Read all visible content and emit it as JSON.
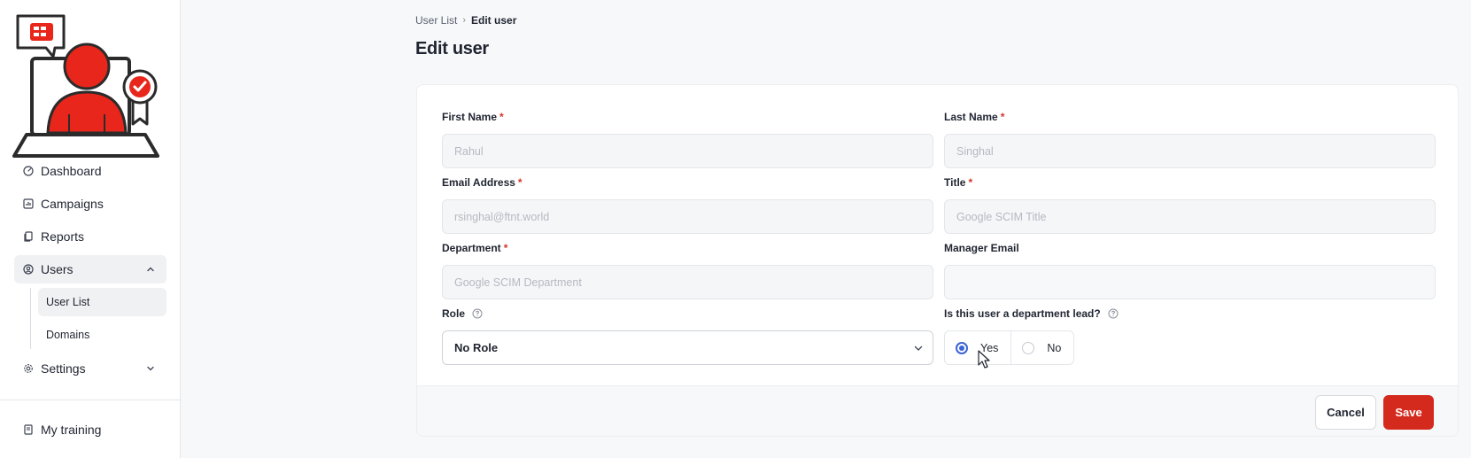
{
  "colors": {
    "accent": "#d42a1e",
    "radio_selected": "#3a63d6",
    "required": "#d63328"
  },
  "sidebar": {
    "items": [
      {
        "label": "Dashboard",
        "icon": "gauge-icon"
      },
      {
        "label": "Campaigns",
        "icon": "chart-icon"
      },
      {
        "label": "Reports",
        "icon": "document-icon"
      },
      {
        "label": "Users",
        "icon": "user-circle-icon",
        "expanded": true,
        "children": [
          {
            "label": "User List",
            "active": true
          },
          {
            "label": "Domains"
          }
        ]
      },
      {
        "label": "Settings",
        "icon": "gear-icon",
        "expanded": false
      }
    ],
    "bottom_items": [
      {
        "label": "My training",
        "icon": "book-icon"
      }
    ]
  },
  "breadcrumb": {
    "parent": "User List",
    "current": "Edit user"
  },
  "page_title": "Edit user",
  "form": {
    "first_name": {
      "label": "First Name",
      "value": "Rahul",
      "required": true
    },
    "last_name": {
      "label": "Last Name",
      "value": "Singhal",
      "required": true
    },
    "email": {
      "label": "Email Address",
      "value": "rsinghal@ftnt.world",
      "required": true
    },
    "title": {
      "label": "Title",
      "value": "Google SCIM Title",
      "required": true
    },
    "department": {
      "label": "Department",
      "value": "Google SCIM Department",
      "required": true
    },
    "manager_email": {
      "label": "Manager Email",
      "value": "",
      "required": false
    },
    "role": {
      "label": "Role",
      "value": "No Role"
    },
    "dept_lead": {
      "label": "Is this user a department lead?",
      "options": [
        "Yes",
        "No"
      ],
      "selected": "Yes"
    },
    "required_mark": "*"
  },
  "actions": {
    "cancel": "Cancel",
    "save": "Save"
  }
}
